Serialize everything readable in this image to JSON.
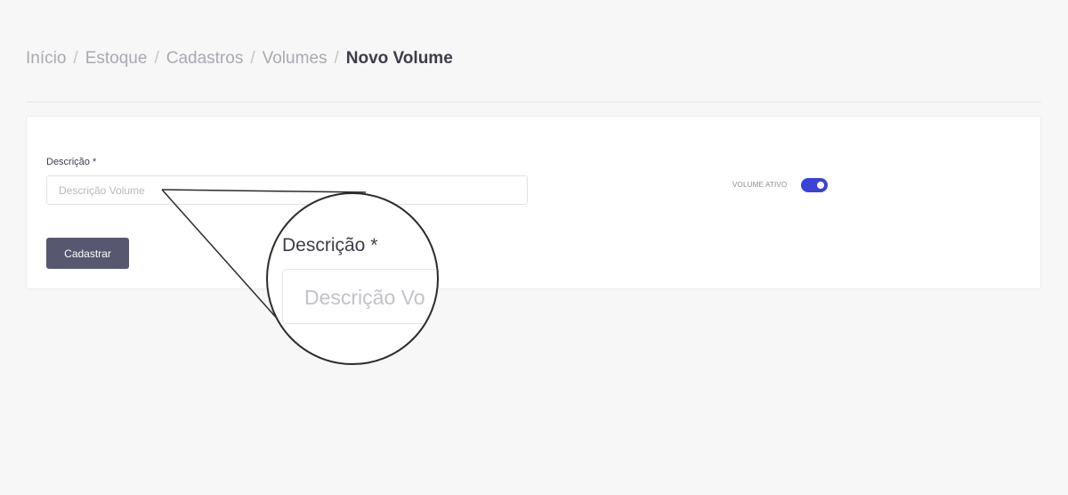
{
  "breadcrumb": {
    "items": [
      "Início",
      "Estoque",
      "Cadastros",
      "Volumes"
    ],
    "separator": "/",
    "current": "Novo Volume"
  },
  "form": {
    "description_label": "Descrição *",
    "description_placeholder": "Descrição Volume",
    "description_value": "",
    "active_label": "VOLUME ATIVO",
    "active_value": true,
    "submit_label": "Cadastrar"
  },
  "magnifier": {
    "label": "Descrição *",
    "placeholder": "Descrição Vo"
  },
  "colors": {
    "accent": "#3a43d8",
    "button": "#575770",
    "text": "#3c3d48",
    "muted": "#a9aab0",
    "background": "#f7f7f8"
  }
}
